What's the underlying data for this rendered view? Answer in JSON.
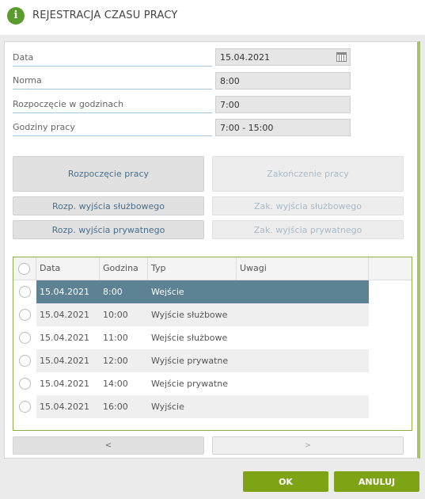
{
  "dialog": {
    "title": "REJESTRACJA CZASU PRACY",
    "info_icon": "i"
  },
  "form": {
    "fields": [
      {
        "label": "Data",
        "value": "15.04.2021"
      },
      {
        "label": "Norma",
        "value": "8:00"
      },
      {
        "label": "Rozpoczęcie w godzinach",
        "value": "7:00"
      },
      {
        "label": "Godziny pracy",
        "value": "7:00 - 15:00"
      }
    ]
  },
  "actions": {
    "start_work": "Rozpoczęcie pracy",
    "end_work": "Zakończenie pracy",
    "start_business_exit": "Rozp. wyjścia służbowego",
    "end_business_exit": "Zak. wyjścia służbowego",
    "start_private_exit": "Rozp. wyjścia prywatnego",
    "end_private_exit": "Zak. wyjścia prywatnego"
  },
  "grid": {
    "headers": {
      "date": "Data",
      "time": "Godzina",
      "type": "Typ",
      "notes": "Uwagi"
    },
    "rows": [
      {
        "date": "15.04.2021",
        "time": "8:00",
        "type": "Wejście",
        "notes": ""
      },
      {
        "date": "15.04.2021",
        "time": "10:00",
        "type": "Wyjście służbowe",
        "notes": ""
      },
      {
        "date": "15.04.2021",
        "time": "11:00",
        "type": "Wejście służbowe",
        "notes": ""
      },
      {
        "date": "15.04.2021",
        "time": "12:00",
        "type": "Wyjście prywatne",
        "notes": ""
      },
      {
        "date": "15.04.2021",
        "time": "14:00",
        "type": "Wejście prywatne",
        "notes": ""
      },
      {
        "date": "15.04.2021",
        "time": "16:00",
        "type": "Wyjście",
        "notes": ""
      }
    ]
  },
  "pager": {
    "prev": "<",
    "next": ">"
  },
  "footer": {
    "ok": "OK",
    "cancel": "ANULUJ"
  },
  "colors": {
    "accent": "#7ea416",
    "selected_row": "#5d8293",
    "grid_border": "#8ab046"
  }
}
